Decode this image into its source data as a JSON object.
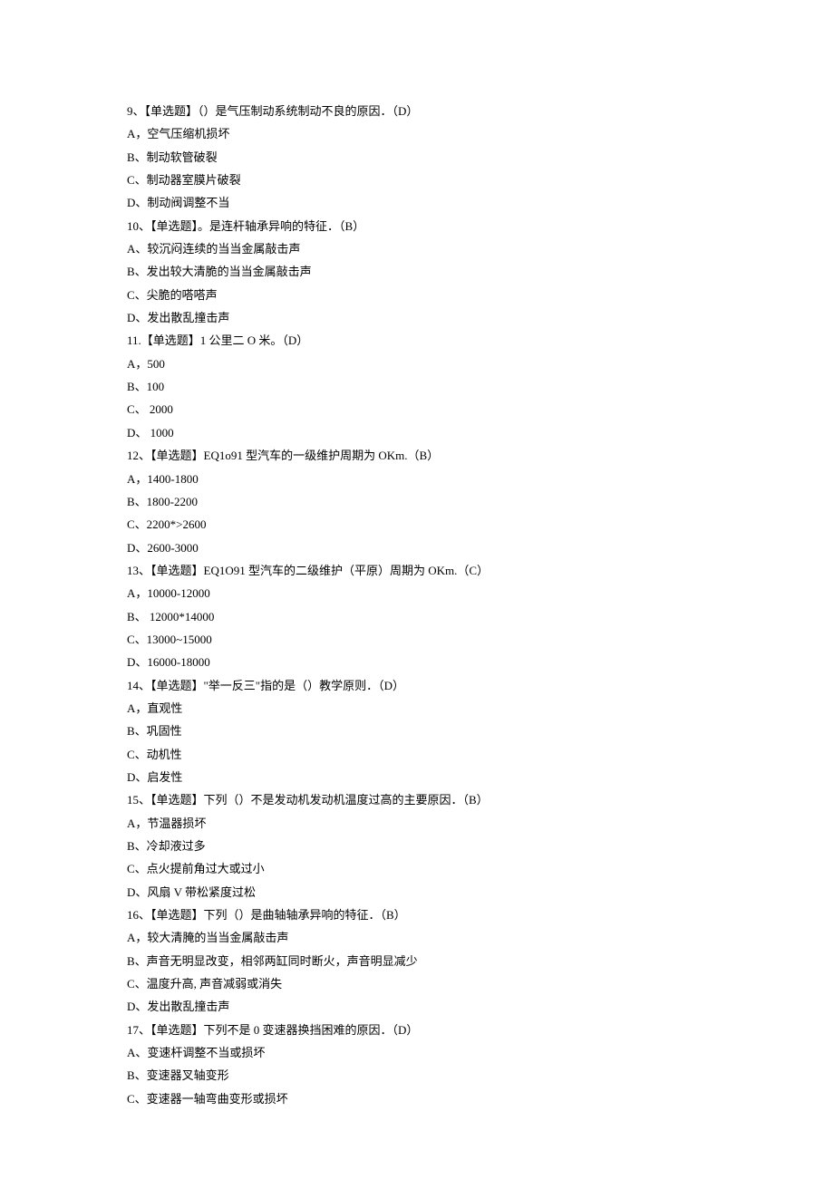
{
  "questions": [
    {
      "stem": "9、【单选题】（）是气压制动系统制动不良的原因．（D）",
      "options": [
        "A，空气压缩机损坏",
        "B、制动软管破裂",
        "C、制动器室膜片破裂",
        "D、制动阀调整不当"
      ]
    },
    {
      "stem": "10、【单选题】。是连杆轴承异响的特征．（B）",
      "options": [
        "A、较沉闷连续的当当金属敲击声",
        "B、发出较大清脆的当当金属敲击声",
        "C、尖脆的嗒嗒声",
        "D、发出散乱撞击声"
      ]
    },
    {
      "stem": "11.【单选题】1 公里二 O 米。（D）",
      "options": [
        "A，500",
        "B、100",
        "C、 2000",
        "D、 1000"
      ]
    },
    {
      "stem": "12、【单选题】EQ1o91 型汽车的一级维护周期为 OKm.（B）",
      "options": [
        "A，1400-1800",
        "B、1800-2200",
        "C、2200*>2600",
        "D、2600-3000"
      ]
    },
    {
      "stem": "13、【单选题】EQ1O91 型汽车的二级维护（平原）周期为 OKm.（C）",
      "options": [
        "A，10000-12000",
        "B、 12000*14000",
        "C、13000~15000",
        "D、16000-18000"
      ]
    },
    {
      "stem": "14、【单选题】\"举一反三\"指的是（）教学原则．（D）",
      "options": [
        "A，直观性",
        "B、巩固性",
        "C、动机性",
        "D、启发性"
      ]
    },
    {
      "stem": "15、【单选题】下列（）不是发动机发动机温度过高的主要原因．（B）",
      "options": [
        "A，节温器损坏",
        "B、冷却液过多",
        "C、点火提前角过大或过小",
        "D、风扇 V 带松紧度过松"
      ]
    },
    {
      "stem": "16、【单选题】下列（）是曲轴轴承异响的特征．（B）",
      "options": [
        "A，较大清腌的当当金属敲击声",
        "B、声音无明显改变，相邻两缸同时断火，声音明显减少",
        "C、温度升高, 声音减弱或消失",
        "D、发出散乱撞击声"
      ]
    },
    {
      "stem": "17、【单选题】下列不是 0 变速器换挡困难的原因．（D）",
      "options": [
        "A、变速杆调整不当或损坏",
        "B、变速器叉轴变形",
        "C、变速器一轴弯曲变形或损坏"
      ]
    }
  ]
}
